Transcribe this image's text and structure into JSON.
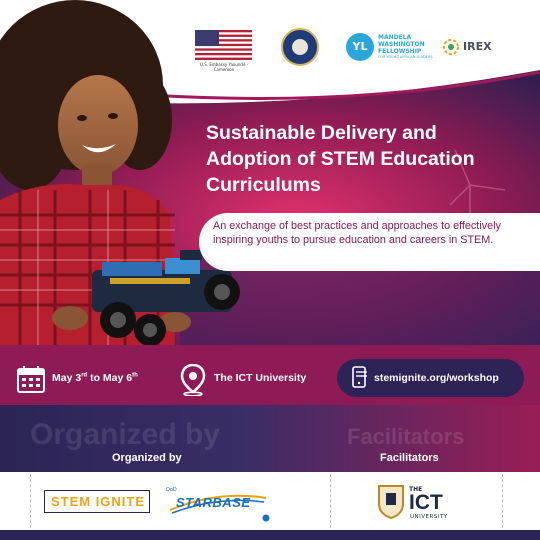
{
  "sponsors": {
    "flag_caption": "U.S. Embassy Yaoundé · Cameroon",
    "mwf_badge": "YL",
    "mwf_name": "MANDELA WASHINGTON FELLOWSHIP",
    "mwf_tagline": "FOR YOUNG AFRICAN LEADERS",
    "irex": "IREX"
  },
  "headline": "Sustainable Delivery and Adoption of STEM Education Curriculums",
  "subheadline": "An exchange of best practices and approaches to effectively inspiring youths to pursue education and careers in STEM.",
  "event": {
    "date_start": "May 3",
    "date_start_sup": "rd",
    "date_to": " to May 6",
    "date_end_sup": "th",
    "venue": "The ICT University",
    "website": "stemignite.org/workshop"
  },
  "partners": {
    "watermark_left": "Organized by",
    "watermark_right": "Facilitators",
    "organized_label": "Organized by",
    "facilitators_label": "Facilitators",
    "stem_logo": "STEM IGNITE",
    "starbase_prefix": "DoD",
    "starbase": "STARBASE",
    "ict_the": "THE",
    "ict_name": "ICT",
    "ict_university": "UNIVERSITY"
  },
  "colors": {
    "brand_magenta": "#8e1b56",
    "brand_navy": "#2b2456",
    "accent_amber": "#e8a317"
  }
}
